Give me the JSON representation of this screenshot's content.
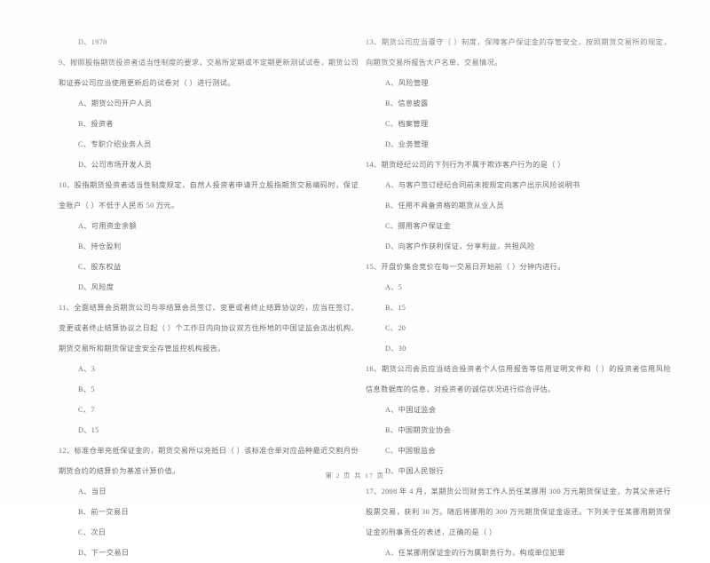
{
  "document": {
    "page_footer": "第 2 页 共 17 页",
    "page_number": "2",
    "total_pages": "17",
    "background_color": "#ffffff",
    "text_color": "#6b6b6b"
  },
  "left_column": [
    {
      "type": "orphan_option",
      "text": "D、1970"
    },
    {
      "type": "question",
      "number": "9",
      "stem": "9、按照股指期货投资者适当性制度的要求，交易所定期或不定期更新测试试卷，期货公司和证券公司应当使用更新后的试卷对（       ）进行测试。",
      "options": [
        "A、期货公司开户人员",
        "B、投资者",
        "C、专职介绍业务人员",
        "D、公司市场开发人员"
      ]
    },
    {
      "type": "question",
      "number": "10",
      "stem": "10、股指期货投资者适当性制度规定，自然人投资者申请开立股指期货交易编码时，保证金账户（       ）不低于人民币 50 万元。",
      "options": [
        "A、可用资金余额",
        "B、持仓盈利",
        "C、股东权益",
        "D、风险度"
      ]
    },
    {
      "type": "question",
      "number": "11",
      "stem": "11、全面结算会员期货公司与非结算会员签订、变更或者终止结算协议的，应当在签订、变更或者终止结算协议之日起（       ）个工作日内向协议双方住所地的中国证监会派出机构、期货交易所和期货保证金安全存管监控机构报告。",
      "options": [
        "A、3",
        "B、5",
        "C、7",
        "D、15"
      ]
    },
    {
      "type": "question",
      "number": "12",
      "stem": "12、标准仓单充抵保证金的，期货交易所以充抵日（       ）该标准仓单对应品种最近交割月份期货合约的结算价为基准计算价值。",
      "options": [
        "A、当日",
        "B、前一交易日",
        "C、次日",
        "D、下一交易日"
      ]
    }
  ],
  "right_column": [
    {
      "type": "question",
      "number": "13",
      "stem": "13、期货公司应当遵守（       ）制度，保障客户保证金的存管安全，按照期货交易所的规定，向期货交易所报告大户名单、交易情况。",
      "options": [
        "A、风险管理",
        "B、信息披露",
        "C、档案管理",
        "D、业务管理"
      ]
    },
    {
      "type": "question",
      "number": "14",
      "stem": "14、期货经纪公司的下列行为不属于欺诈客户行为的是（       ）",
      "options": [
        "A、与客户签订经纪合同前未按规定向客户出示风险说明书",
        "B、任用不具备资格的期货从业人员",
        "C、挪用客户保证金",
        "D、向客户作获利保证，分享利益，共担风险"
      ]
    },
    {
      "type": "question",
      "number": "15",
      "stem": "15、开盘价集合竞价在每一交易日开始前（       ）分钟内进行。",
      "options": [
        "A、5",
        "B、15",
        "C、20",
        "D、30"
      ]
    },
    {
      "type": "question",
      "number": "16",
      "stem": "16、期货公司会员应当结合投资者个人信用报告等信用证明文件和（       ）的投资者信用风险信息数据库的信息，对投资者的诚信状况进行综合评估。",
      "options": [
        "A、中国证监会",
        "B、中国期货业协会",
        "C、中国银监会",
        "D、中国人民银行"
      ]
    },
    {
      "type": "question",
      "number": "17",
      "stem": "17、2008 年 4 月，某期货公司财务工作人员任某挪用 300 万元期货保证金，为其父亲进行股票交易，获利 30 万。随后将挪用的 300 万元期货保证金返还。下列关于任某挪用期货保证金的刑事责任的表述，正确的是（       ）",
      "options": [
        "A、任某挪用保证金的行为属职务行为，构成单位犯罪"
      ]
    }
  ]
}
